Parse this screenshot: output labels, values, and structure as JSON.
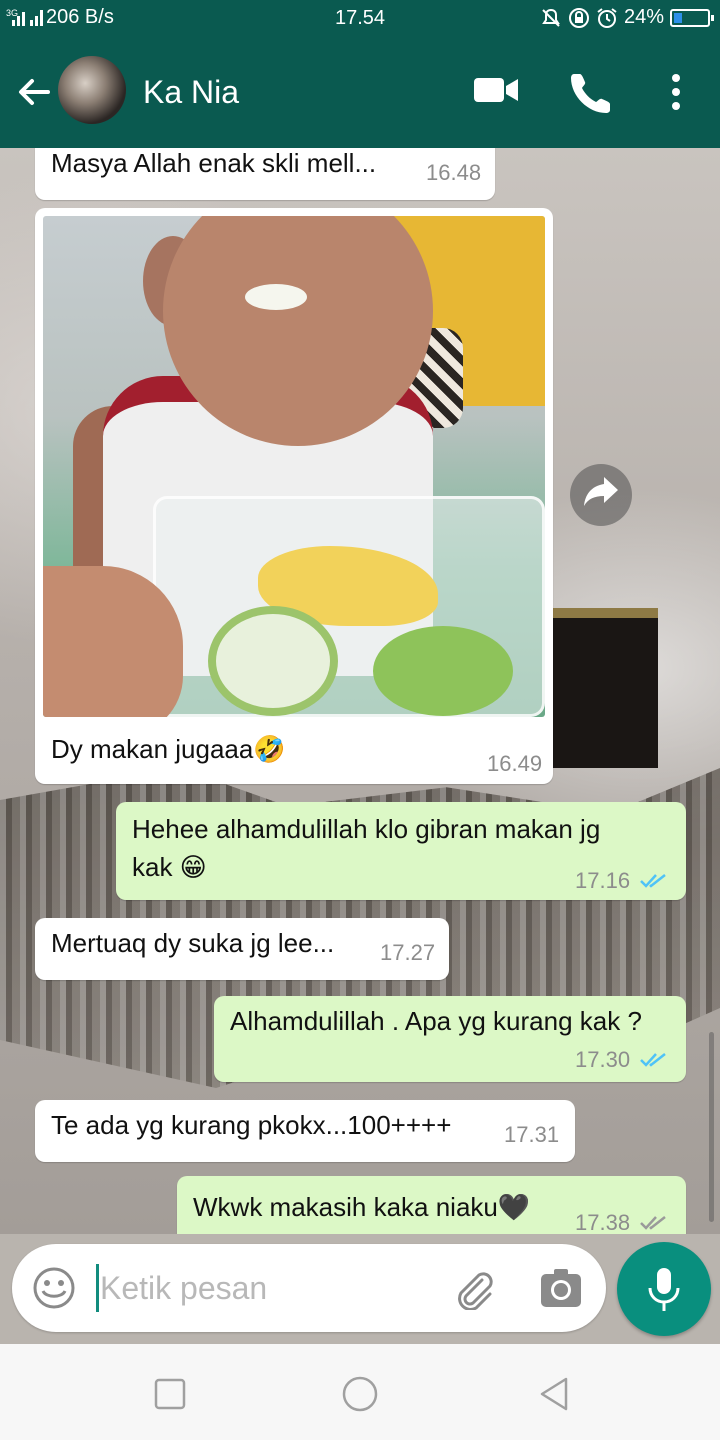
{
  "status_bar": {
    "network_type": "3G",
    "network_speed": "206 B/s",
    "time": "17.54",
    "battery": "24%",
    "battery_level": 0.24
  },
  "header": {
    "contact_name": "Ka Nia"
  },
  "messages": [
    {
      "type": "in",
      "text": "Masya Allah enak skli mell...",
      "time": "16.48"
    },
    {
      "type": "in",
      "caption": "Dy makan jugaaa🤣",
      "time": "16.49"
    },
    {
      "type": "out",
      "line1": "Hehee alhamdulillah klo gibran makan jg",
      "line2": "kak 😁",
      "time": "17.16",
      "status": "read"
    },
    {
      "type": "in",
      "text": "Mertuaq dy suka jg lee...",
      "time": "17.27"
    },
    {
      "type": "out",
      "text": "Alhamdulillah . Apa yg kurang kak ?",
      "time": "17.30",
      "status": "read"
    },
    {
      "type": "in",
      "text": "Te ada yg kurang pkokx...100++++",
      "time": "17.31"
    },
    {
      "type": "out",
      "text": "Wkwk makasih kaka niaku🖤",
      "time": "17.38",
      "status": "delivered"
    }
  ],
  "input": {
    "placeholder": "Ketik pesan",
    "value": ""
  },
  "icons": {
    "back": "arrow-left-icon",
    "video_call": "video-camera-icon",
    "voice_call": "phone-icon",
    "menu": "more-vert-icon",
    "forward": "share-icon",
    "emoji": "smiley-icon",
    "attach": "paperclip-icon",
    "camera": "camera-icon",
    "mic": "microphone-icon"
  },
  "colors": {
    "header": "#0a5a50",
    "outgoing_bubble": "#dcf8c6",
    "incoming_bubble": "#ffffff",
    "read_ticks": "#4fc3f7",
    "mic_button": "#098f7e"
  }
}
